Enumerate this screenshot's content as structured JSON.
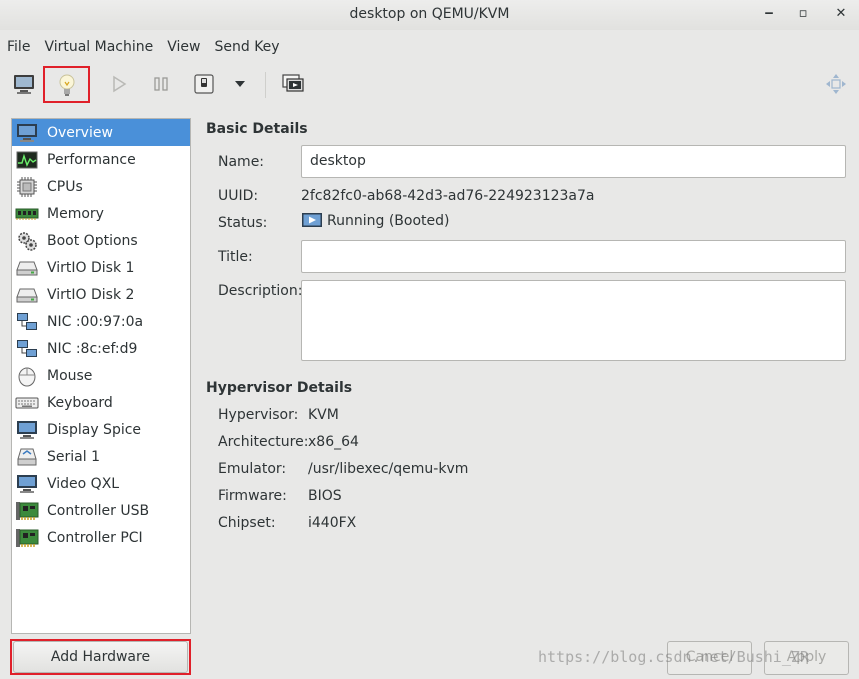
{
  "window": {
    "title": "desktop on QEMU/KVM",
    "minimize": "‒",
    "maximize": "▫",
    "close": "✕"
  },
  "menu": [
    "File",
    "Virtual Machine",
    "View",
    "Send Key"
  ],
  "toolbar": {
    "icons": [
      "console-icon",
      "lightbulb-icon",
      "play-icon",
      "pause-icon",
      "power-icon",
      "dropdown-arrow-icon",
      "snapshot-icon",
      "fullscreen-icon"
    ]
  },
  "sidebar": {
    "items": [
      {
        "label": "Overview",
        "icon": "monitor-icon"
      },
      {
        "label": "Performance",
        "icon": "performance-graph-icon"
      },
      {
        "label": "CPUs",
        "icon": "cpu-chip-icon"
      },
      {
        "label": "Memory",
        "icon": "memory-icon"
      },
      {
        "label": "Boot Options",
        "icon": "gears-icon"
      },
      {
        "label": "VirtIO Disk 1",
        "icon": "disk-icon"
      },
      {
        "label": "VirtIO Disk 2",
        "icon": "disk-icon"
      },
      {
        "label": "NIC :00:97:0a",
        "icon": "network-icon"
      },
      {
        "label": "NIC :8c:ef:d9",
        "icon": "network-icon"
      },
      {
        "label": "Mouse",
        "icon": "mouse-icon"
      },
      {
        "label": "Keyboard",
        "icon": "keyboard-icon"
      },
      {
        "label": "Display Spice",
        "icon": "display-icon"
      },
      {
        "label": "Serial 1",
        "icon": "serial-icon"
      },
      {
        "label": "Video QXL",
        "icon": "video-icon"
      },
      {
        "label": "Controller USB",
        "icon": "controller-card-icon"
      },
      {
        "label": "Controller PCI",
        "icon": "controller-card-icon"
      }
    ],
    "selected": 0,
    "add_hardware": "Add Hardware"
  },
  "basic": {
    "title": "Basic Details",
    "name_label": "Name:",
    "name_value": "desktop",
    "uuid_label": "UUID:",
    "uuid_value": "2fc82fc0-ab68-42d3-ad76-224923123a7a",
    "status_label": "Status:",
    "status_value": "Running (Booted)",
    "title_label": "Title:",
    "title_value": "",
    "description_label": "Description:",
    "description_value": ""
  },
  "hypervisor": {
    "title": "Hypervisor Details",
    "rows": [
      {
        "label": "Hypervisor:",
        "value": "KVM"
      },
      {
        "label": "Architecture:",
        "value": "x86_64"
      },
      {
        "label": "Emulator:",
        "value": "/usr/libexec/qemu-kvm"
      },
      {
        "label": "Firmware:",
        "value": "BIOS"
      },
      {
        "label": "Chipset:",
        "value": "i440FX"
      }
    ]
  },
  "buttons": {
    "cancel": "Cancel",
    "apply": "Apply"
  },
  "watermark": "https://blog.csdn.net/Bushi_ZR",
  "colors": {
    "selection": "#4a90d9",
    "highlight_box": "#e0202a"
  }
}
